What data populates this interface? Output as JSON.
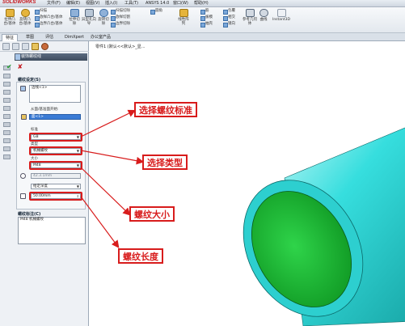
{
  "app": {
    "logo": "SOLIDWORKS"
  },
  "menu": [
    "文件(F)",
    "编辑(E)",
    "视图(V)",
    "插入(I)",
    "工具(T)",
    "ANSYS 14.0",
    "窗口(W)",
    "帮助(H)"
  ],
  "ribbon": {
    "buttons": [
      {
        "label": "拉伸凸台/基体"
      },
      {
        "label": "旋转凸台/基体"
      },
      {
        "label": "拉伸切除"
      },
      {
        "label": "异型孔向导"
      },
      {
        "label": "旋转切除"
      },
      {
        "label": "线性阵列"
      },
      {
        "label": "参考几何体"
      },
      {
        "label": "曲线"
      },
      {
        "label": "Instant3D"
      }
    ],
    "small": [
      {
        "label": "扫描"
      },
      {
        "label": "放样凸台/基体"
      },
      {
        "label": "边界凸台/基体"
      },
      {
        "label": "扫描切除"
      },
      {
        "label": "放样切割"
      },
      {
        "label": "边界切除"
      },
      {
        "label": "圆角"
      },
      {
        "label": "筋"
      },
      {
        "label": "包覆"
      },
      {
        "label": "拔模"
      },
      {
        "label": "相交"
      },
      {
        "label": "抽壳"
      },
      {
        "label": "圆顶"
      },
      {
        "label": "镜向"
      }
    ]
  },
  "tabs": [
    "特征",
    "草图",
    "评估",
    "DimXpert",
    "办公室产品"
  ],
  "breadcrumb": "零件1 (默认<<默认>_显...",
  "feature_manager": {
    "title": "装饰螺纹线",
    "ok": "✔",
    "cancel": "✘",
    "thread_settings_title": "螺纹设定(S)",
    "edge_value": "边线<1>",
    "start_label": "从面/基准面开始:",
    "start_value": "面<1>",
    "standard_label": "标准",
    "standard_value": "GB",
    "type_label": "类型",
    "type_value": "机械螺纹",
    "size_label": "大小",
    "size_value": "M48",
    "diameter_value": "42.3.1mm",
    "end_condition_value": "给定深度",
    "length_value": "50.00mm",
    "callout_title": "螺纹标注(C)",
    "callout_value": "M48 机械螺纹"
  },
  "annotations": {
    "standard": "选择螺纹标准",
    "type": "选择类型",
    "size": "螺纹大小",
    "length": "螺纹长度"
  },
  "colors": {
    "annotation_red": "#d81c1c",
    "cylinder_cyan": "#2fd6d6",
    "end_face_green": "#22c63a",
    "selection_blue": "#3a7bd5"
  }
}
